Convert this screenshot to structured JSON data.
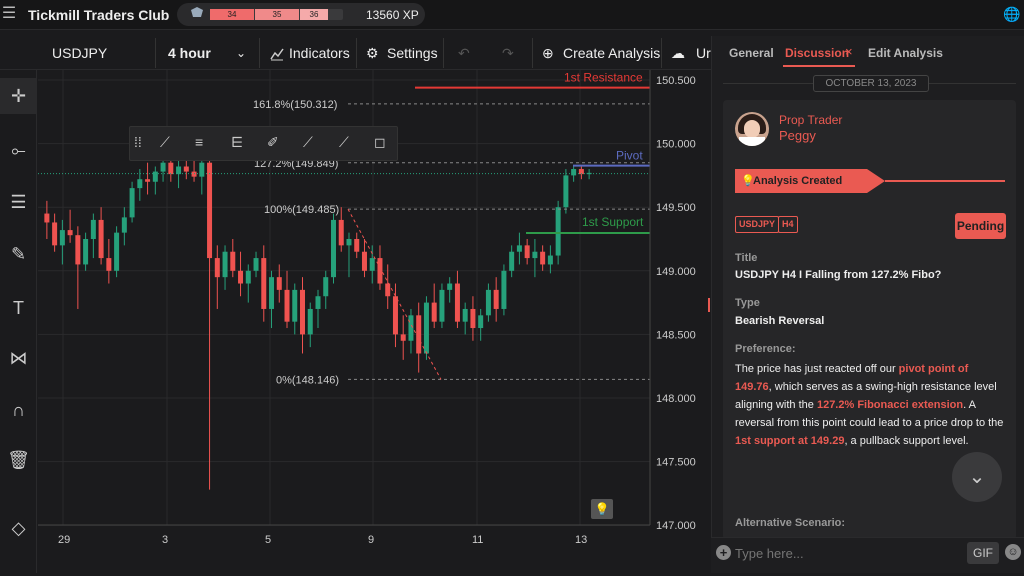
{
  "app": {
    "title": "Tickmill Traders Club",
    "xp_segments": [
      "34",
      "35",
      "36"
    ],
    "xp_value": "13560 XP"
  },
  "toolbar": {
    "symbol": "USDJPY",
    "timeframe": "4 hour",
    "indicators": "Indicators",
    "settings": "Settings",
    "create": "Create Analysis",
    "upload": "Ur"
  },
  "chart": {
    "price_labels": [
      "150.500",
      "150.000",
      "149.500",
      "149.000",
      "148.500",
      "148.000",
      "147.500",
      "147.000"
    ],
    "date_labels": [
      "29",
      "3",
      "5",
      "9",
      "11",
      "13"
    ],
    "fibo": {
      "f1618": "161.8%(150.312)",
      "f1272": "127.2%(149.849)",
      "f100": "100%(149.485)",
      "f0": "0%(148.146)"
    },
    "levels": {
      "resistance_label": "1st Resistance",
      "resistance_price": "150.44",
      "pivot_label": "Pivot",
      "pivot_price": "149.827",
      "current_price": "149.764",
      "support_label": "1st Support",
      "support_price": "149.297"
    },
    "colors": {
      "up": "#26a17b",
      "down": "#ef5350",
      "resistance": "#e53935",
      "pivot": "#5c6bc0",
      "support": "#2e9b4a"
    }
  },
  "panel": {
    "tabs": [
      "General",
      "Discussion",
      "Edit Analysis"
    ],
    "date": "OCTOBER 13, 2023",
    "author_role": "Prop Trader",
    "author_name": "Peggy",
    "event": "Analysis Created",
    "tags": [
      "USDJPY",
      "H4"
    ],
    "status": "Pending",
    "title_label": "Title",
    "title": "USDJPY H4 I Falling from 127.2% Fibo?",
    "type_label": "Type",
    "type": "Bearish Reversal",
    "pref_label": "Preference:",
    "pref_parts": [
      " The price has just reacted off our ",
      "pivot point of 149.76",
      ", which serves as a swing-high resistance level aligning with the ",
      "127.2% Fibonacci extension",
      ". A reversal from this point could lead to a price drop to the ",
      "1st support at 149.29",
      ", a pullback support level."
    ],
    "alt_label": "Alternative Scenario:",
    "composer_placeholder": "Type here...",
    "gif": "GIF"
  }
}
